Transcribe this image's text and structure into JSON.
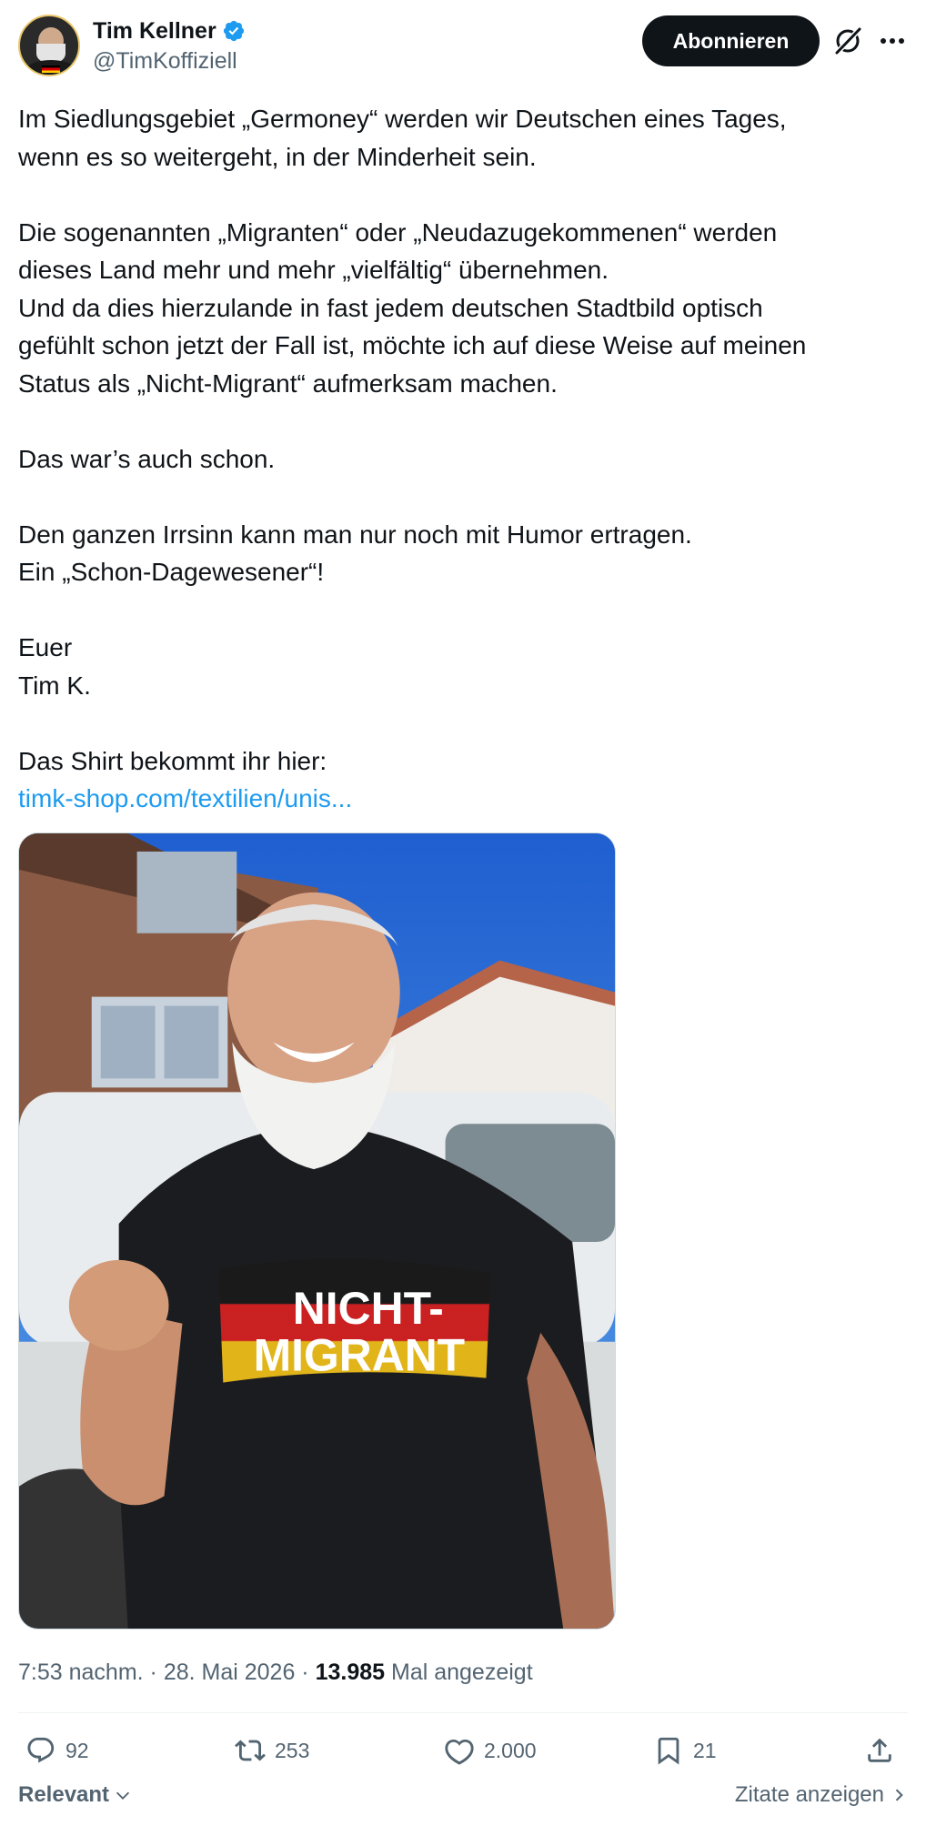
{
  "author": {
    "display_name": "Tim Kellner",
    "handle": "@TimKoffiziell",
    "verified": true
  },
  "header": {
    "subscribe_label": "Abonnieren",
    "grok_icon": "grok-icon",
    "more_icon": "more-horizontal-icon"
  },
  "tweet": {
    "paragraph_1": "Im Siedlungsgebiet „Germoney“ werden wir Deutschen eines Tages,\nwenn es so weitergeht, in der Minderheit sein.",
    "paragraph_2": "Die sogenannten „Migranten“ oder „Neudazugekommenen“ werden\ndieses Land mehr und mehr „vielfältig“ übernehmen.\nUnd da dies hierzulande in fast jedem deutschen Stadtbild optisch\ngefühlt schon jetzt der Fall ist, möchte ich auf diese Weise auf meinen\nStatus als „Nicht-Migrant“ aufmerksam machen.",
    "paragraph_3": "Das war’s auch schon.",
    "paragraph_4": "Den ganzen Irrsinn kann man nur noch mit Humor ertragen.\nEin „Schon-Dagewesener“!",
    "paragraph_5": "Euer\nTim K.",
    "paragraph_6": "Das Shirt bekommt ihr hier:",
    "link_text": "timk-shop.com/textilien/unis..."
  },
  "media": {
    "shirt_text_line_1": "NICHT-",
    "shirt_text_line_2": "MIGRANT"
  },
  "meta": {
    "time": "7:53 nachm.",
    "separator": " · ",
    "date": "28. Mai 2026",
    "views_count": "13.985",
    "views_label": " Mal angezeigt"
  },
  "actions": {
    "replies": "92",
    "reposts": "253",
    "likes": "2.000",
    "bookmarks": "21"
  },
  "footer": {
    "sort_label": "Relevant",
    "quotes_label": "Zitate anzeigen"
  },
  "colors": {
    "link": "#1d9bf0",
    "text": "#0f1419",
    "muted": "#536471",
    "verified": "#1d9bf0"
  }
}
